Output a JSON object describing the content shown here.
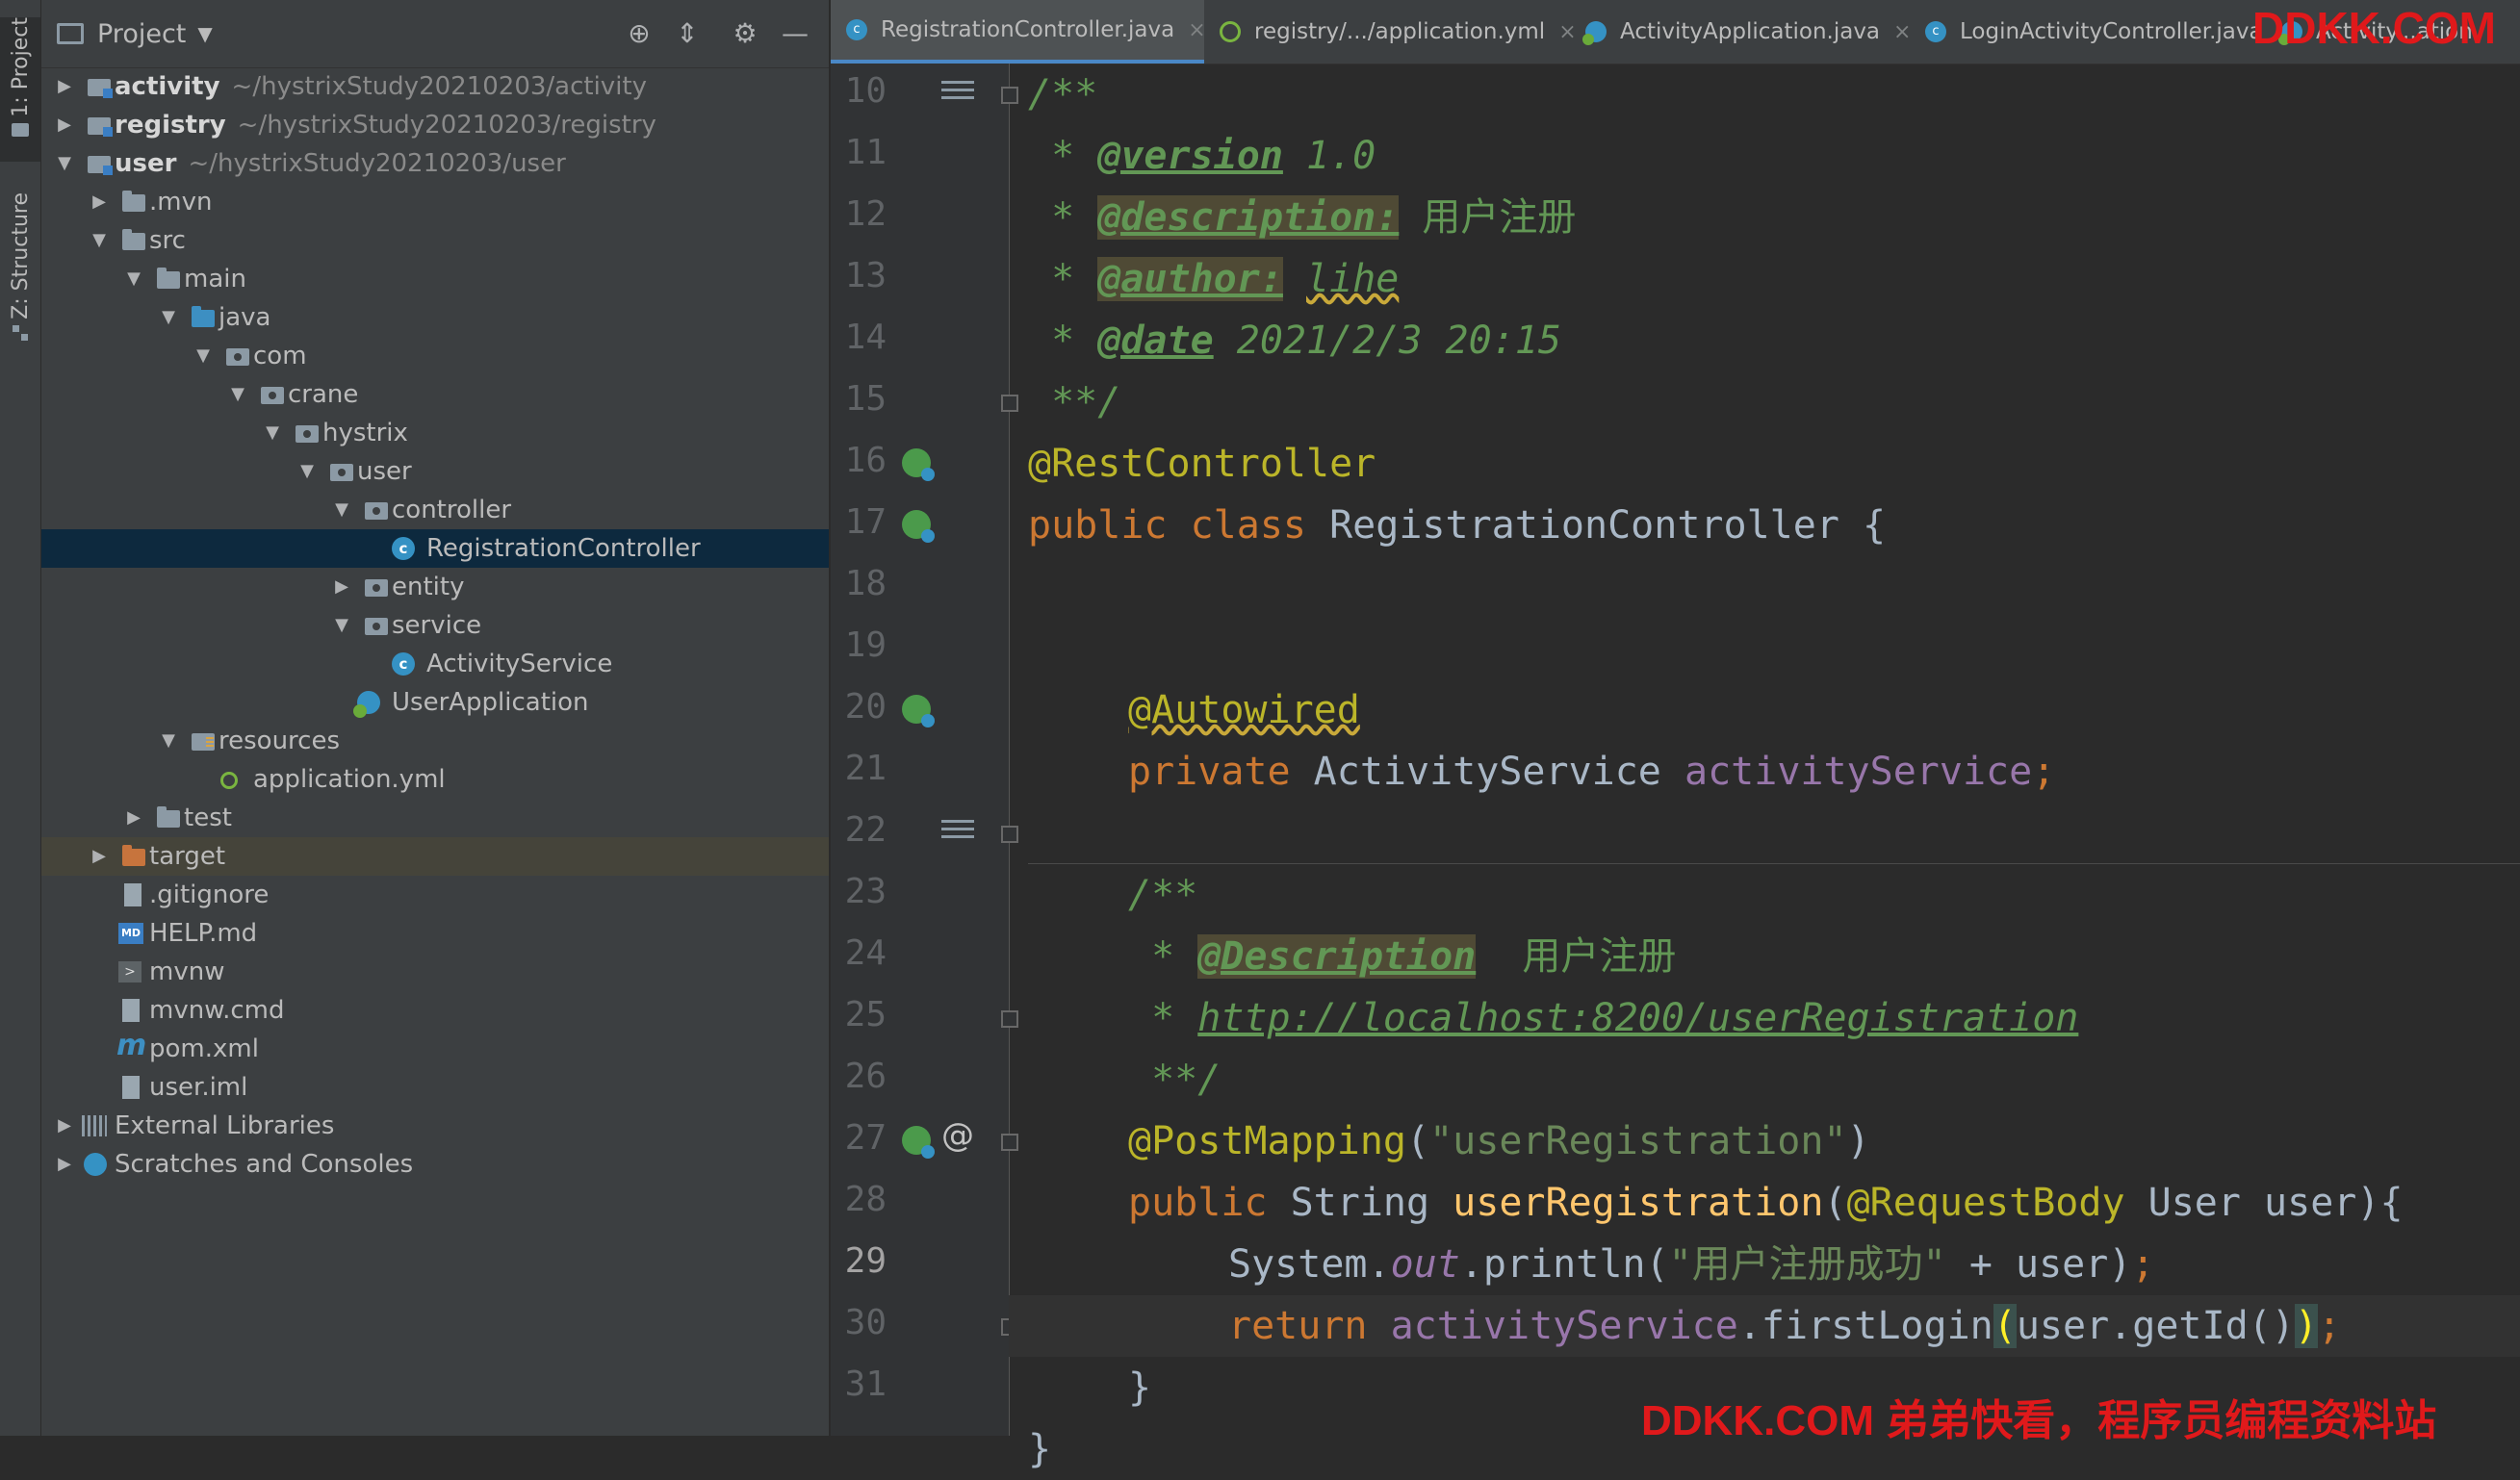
{
  "tool_window_tabs": {
    "project": "1: Project",
    "structure": "Z: Structure"
  },
  "project_panel": {
    "title": "Project",
    "tree": [
      {
        "label": "activity",
        "path": "~/hystrixStudy20210203/activity",
        "icon": "module-icon",
        "bold": true
      },
      {
        "label": "registry",
        "path": "~/hystrixStudy20210203/registry",
        "icon": "module-icon",
        "bold": true
      },
      {
        "label": "user",
        "path": "~/hystrixStudy20210203/user",
        "icon": "module-icon",
        "bold": true
      },
      {
        "label": ".mvn",
        "icon": "folder-icon"
      },
      {
        "label": "src",
        "icon": "folder-icon"
      },
      {
        "label": "main",
        "icon": "folder-icon"
      },
      {
        "label": "java",
        "icon": "source-folder-icon"
      },
      {
        "label": "com",
        "icon": "package-icon"
      },
      {
        "label": "crane",
        "icon": "package-icon"
      },
      {
        "label": "hystrix",
        "icon": "package-icon"
      },
      {
        "label": "user",
        "icon": "package-icon"
      },
      {
        "label": "controller",
        "icon": "package-icon"
      },
      {
        "label": "RegistrationController",
        "icon": "class-icon"
      },
      {
        "label": "entity",
        "icon": "package-icon"
      },
      {
        "label": "service",
        "icon": "package-icon"
      },
      {
        "label": "ActivityService",
        "icon": "class-icon"
      },
      {
        "label": "UserApplication",
        "icon": "spring-class-icon"
      },
      {
        "label": "resources",
        "icon": "resources-folder-icon"
      },
      {
        "label": "application.yml",
        "icon": "yml-icon"
      },
      {
        "label": "test",
        "icon": "folder-icon"
      },
      {
        "label": "target",
        "icon": "excluded-folder-icon"
      },
      {
        "label": ".gitignore",
        "icon": "gitignore-icon"
      },
      {
        "label": "HELP.md",
        "icon": "markdown-icon"
      },
      {
        "label": "mvnw",
        "icon": "terminal-icon"
      },
      {
        "label": "mvnw.cmd",
        "icon": "file-icon"
      },
      {
        "label": "pom.xml",
        "icon": "maven-icon"
      },
      {
        "label": "user.iml",
        "icon": "file-icon"
      },
      {
        "label": "External Libraries",
        "icon": "libraries-icon"
      },
      {
        "label": "Scratches and Consoles",
        "icon": "scratches-icon"
      }
    ]
  },
  "tabs": [
    {
      "label": "RegistrationController.java",
      "active": true
    },
    {
      "label": "registry/.../application.yml"
    },
    {
      "label": "ActivityApplication.java"
    },
    {
      "label": "LoginActivityController.java"
    },
    {
      "label": "Activity...ation"
    }
  ],
  "editor": {
    "line_numbers": [
      "10",
      "11",
      "12",
      "13",
      "14",
      "15",
      "16",
      "17",
      "18",
      "19",
      "20",
      "21",
      "22",
      "23",
      "24",
      "25",
      "26",
      "27",
      "28",
      "29",
      "30",
      "31"
    ],
    "current_line": "29",
    "code": {
      "l10": "/**",
      "l11_a": " * ",
      "l11_tag": "@version",
      "l11_b": " 1.0",
      "l12_a": " * ",
      "l12_tag": "@description:",
      "l12_b": " 用户注册",
      "l13_a": " * ",
      "l13_tag": "@author:",
      "l13_sp": " ",
      "l13_b": "lihe",
      "l14_a": " * ",
      "l14_tag": "@date",
      "l14_b": " 2021/2/3 20:15",
      "l15": " **/",
      "l16": "@RestController",
      "l17_kw1": "public",
      "l17_kw2": "class",
      "l17_b": " RegistrationController {",
      "l19": "@Autowired",
      "l20_kw": "private",
      "l20_type": " ActivityService ",
      "l20_fld": "activityService",
      "l20_semi": ";",
      "l22": "/**",
      "l23_a": " * ",
      "l23_tag": "@Description",
      "l23_b": "  用户注册",
      "l24_a": " * ",
      "l24_link": "http://localhost:8200/userRegistration",
      "l25": " **/",
      "l26_ann": "@PostMapping",
      "l26_p1": "(",
      "l26_str": "\"userRegistration\"",
      "l26_p2": ")",
      "l27_kw": "public",
      "l27_type": " String ",
      "l27_mth": "userRegistration",
      "l27_p1": "(",
      "l27_ann": "@RequestBody",
      "l27_b": " User user){",
      "l28_a": "System.",
      "l28_stat": "out",
      "l28_b": ".println(",
      "l28_str": "\"用户注册成功\"",
      "l28_c": " + user)",
      "l28_semi": ";",
      "l29_kw": "return",
      "l29_sp": " ",
      "l29_fld": "activityService",
      "l29_b": ".firstLogin",
      "l29_p1": "(",
      "l29_c": "user.getId()",
      "l29_p2": ")",
      "l29_semi": ";",
      "l30": "}",
      "l31": "}"
    }
  },
  "watermarks": {
    "top": "DDKK.COM",
    "bottom": "DDKK.COM 弟弟快看，程序员编程资料站"
  },
  "colors": {
    "keyword": "#cc7832",
    "annotation": "#bbb529",
    "doc_comment": "#629755",
    "string": "#6a8759",
    "field": "#9876aa",
    "method": "#ffc66d",
    "selection": "#0d293e",
    "watermark": "#e0191b"
  }
}
